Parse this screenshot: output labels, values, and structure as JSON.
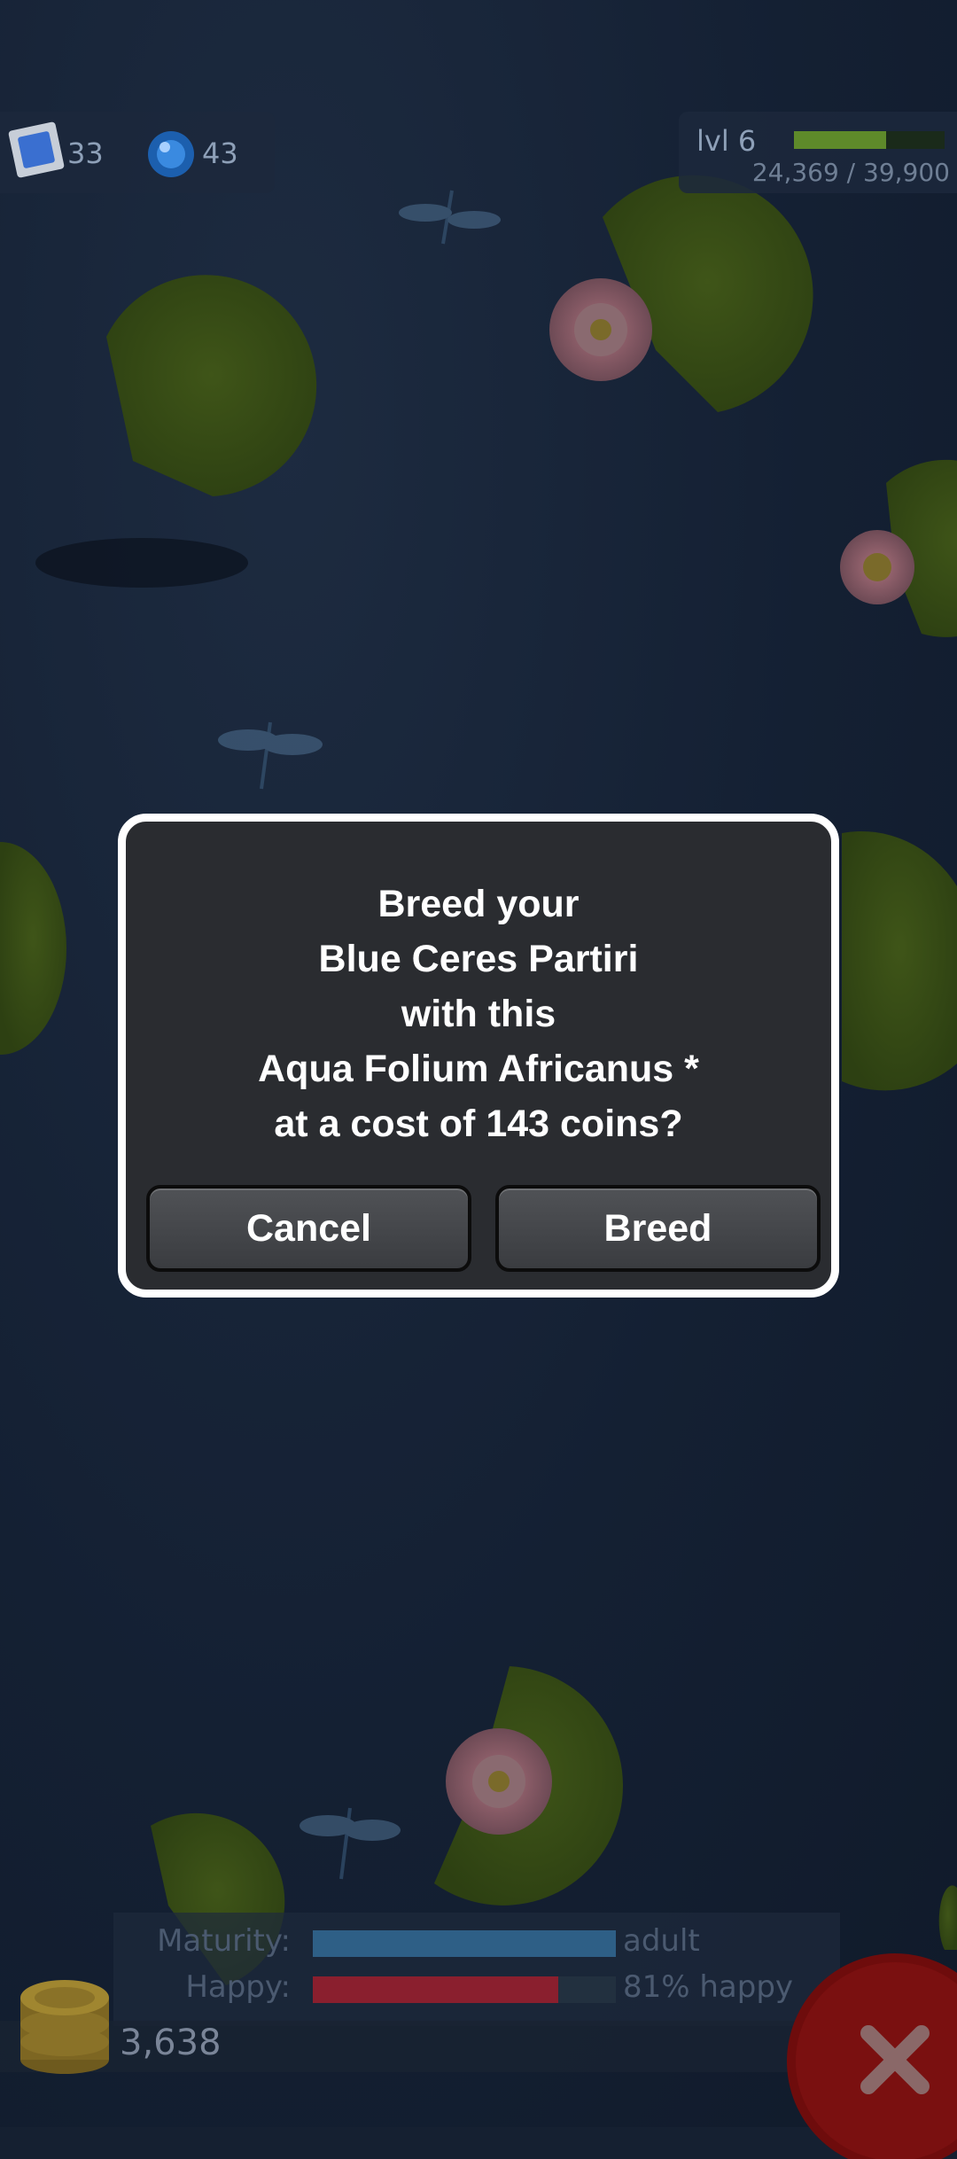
{
  "hud": {
    "gems_blue": "33",
    "gems_orb": "43",
    "level_label": "lvl 6",
    "xp_text": "24,369 / 39,900",
    "xp_progress": 0.61
  },
  "dialog": {
    "lines": [
      "Breed your",
      "Blue Ceres Partiri",
      "with this",
      "Aqua Folium Africanus *",
      "at a cost of 143 coins?"
    ],
    "cancel_label": "Cancel",
    "breed_label": "Breed"
  },
  "stats": {
    "maturity_label": "Maturity:",
    "maturity_value": "adult",
    "maturity_progress": 1.0,
    "happy_label": "Happy:",
    "happy_value": "81% happy",
    "happy_progress": 0.81
  },
  "coins": "3,638",
  "colors": {
    "pond": "#152031",
    "lily_pad": "#6a8c2a",
    "dialog_bg": "#2a2c30",
    "xp_bar": "#5e8a2a",
    "maturity_bar": "#2e5f86",
    "happy_bar": "#8a1f2e",
    "close_button": "#b01818"
  },
  "icons": {
    "stamp": "stamp-icon",
    "orb": "orb-icon",
    "coins": "coin-stack-icon",
    "close": "close-icon",
    "lily_pad": "lily-pad",
    "dragonfly": "dragonfly"
  }
}
